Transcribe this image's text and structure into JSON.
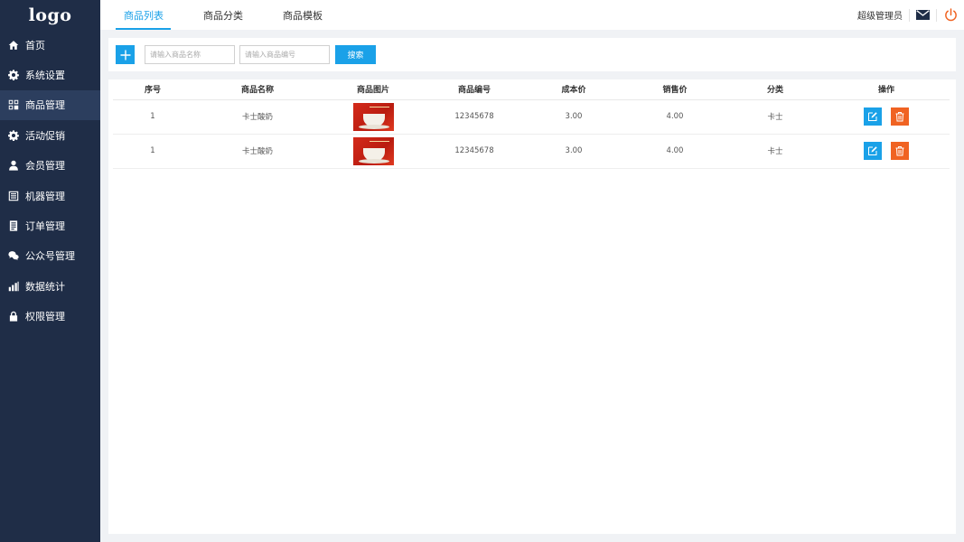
{
  "logo": "logo",
  "sidebar": {
    "items": [
      {
        "label": "首页",
        "icon": "home-icon"
      },
      {
        "label": "系统设置",
        "icon": "gear-icon"
      },
      {
        "label": "商品管理",
        "icon": "grid-icon",
        "active": true
      },
      {
        "label": "活动促销",
        "icon": "gear-icon"
      },
      {
        "label": "会员管理",
        "icon": "user-icon"
      },
      {
        "label": "机器管理",
        "icon": "machine-icon"
      },
      {
        "label": "订单管理",
        "icon": "document-icon"
      },
      {
        "label": "公众号管理",
        "icon": "wechat-icon"
      },
      {
        "label": "数据统计",
        "icon": "bar-chart-icon"
      },
      {
        "label": "权限管理",
        "icon": "lock-icon"
      }
    ]
  },
  "topbar": {
    "tabs": [
      {
        "label": "商品列表",
        "active": true
      },
      {
        "label": "商品分类"
      },
      {
        "label": "商品模板"
      }
    ],
    "username": "超级管理员"
  },
  "search": {
    "name_placeholder": "请输入商品名称",
    "code_placeholder": "请输入商品编号",
    "button_label": "搜索"
  },
  "table": {
    "headers": [
      "序号",
      "商品名称",
      "商品图片",
      "商品编号",
      "成本价",
      "销售价",
      "分类",
      "操作"
    ],
    "rows": [
      {
        "index": "1",
        "name": "卡士酸奶",
        "code": "12345678",
        "cost": "3.00",
        "price": "4.00",
        "category": "卡士"
      },
      {
        "index": "1",
        "name": "卡士酸奶",
        "code": "12345678",
        "cost": "3.00",
        "price": "4.00",
        "category": "卡士"
      }
    ]
  },
  "colors": {
    "sidebar_bg": "#1f2d47",
    "accent": "#1aa1e8",
    "delete": "#f06322"
  }
}
